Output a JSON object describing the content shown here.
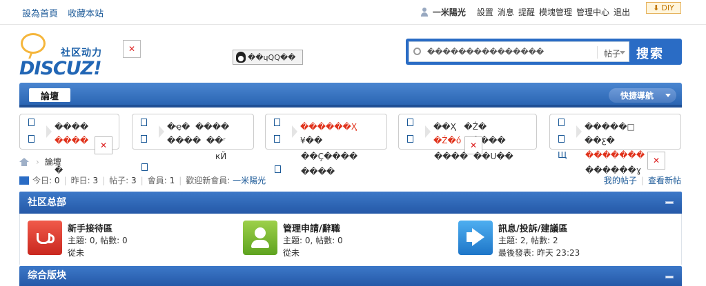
{
  "topbar": {
    "set_home": "設為首頁",
    "bookmark": "收藏本站",
    "username": "一米陽光",
    "links": [
      "設置",
      "消息",
      "提醒",
      "模塊管理",
      "管理中心",
      "退出"
    ],
    "diy": "DIY"
  },
  "logo": {
    "cn": "社区动力",
    "en": "DISCUZ!"
  },
  "qq_label": "��ɥQQ��",
  "search": {
    "placeholder": "���������������",
    "type": "帖子",
    "button": "搜索"
  },
  "nav": {
    "tab": "論壇",
    "quick": "快捷導航"
  },
  "ads": {
    "box1": [
      "����",
      "����",
      "�"
    ],
    "box2": [
      "�ҿ�",
      "����",
      "����",
      "��ʳ",
      "кЙ"
    ],
    "box3": [
      "������Ҳ",
      "¥��",
      "��Ç����",
      "����"
    ],
    "box4": [
      "��Ҳ",
      "�Ź�",
      "�Ź�ó",
      "����",
      "����",
      "��U��"
    ],
    "box5": [
      "�����□",
      "��ƹ�",
      "�������",
      "������ɣ"
    ],
    "box5_marker": "Щ"
  },
  "breadcrumb": {
    "current": "論壇"
  },
  "stats": {
    "today_label": "今日:",
    "today": "0",
    "yesterday_label": "昨日:",
    "yesterday": "3",
    "posts_label": "帖子:",
    "posts": "3",
    "members_label": "會員:",
    "members": "1",
    "welcome_label": "歡迎新會員:",
    "new_member": "一米陽光"
  },
  "right_links": {
    "my_posts": "我的帖子",
    "new_posts": "查看新帖"
  },
  "categories": [
    {
      "title": "社区总部",
      "forums": [
        {
          "name": "新手接待區",
          "meta": "主題: 0, 帖數: 0",
          "last": "從未"
        },
        {
          "name": "管理申請/辭職",
          "meta": "主題: 0, 帖數: 0",
          "last": "從未"
        },
        {
          "name": "訊息/投訴/建議區",
          "meta": "主題: 2, 帖數: 2",
          "last": "最後發表: 昨天 23:23"
        }
      ]
    },
    {
      "title": "综合版块"
    }
  ]
}
